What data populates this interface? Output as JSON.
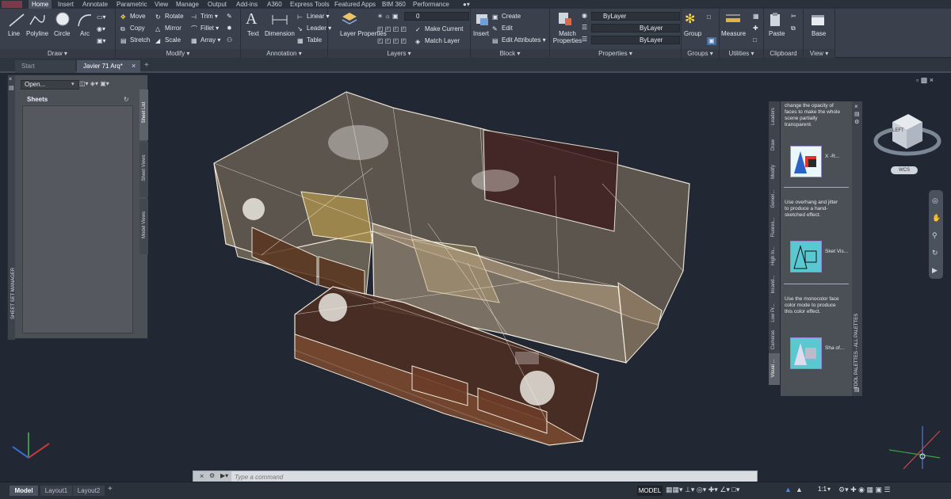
{
  "ribbon_tabs": [
    "Home",
    "Insert",
    "Annotate",
    "Parametric",
    "View",
    "Manage",
    "Output",
    "Add-ins",
    "A360",
    "Express Tools",
    "Featured Apps",
    "BIM 360",
    "Performance"
  ],
  "draw": {
    "title": "Draw",
    "line": "Line",
    "polyline": "Polyline",
    "circle": "Circle",
    "arc": "Arc"
  },
  "modify": {
    "title": "Modify",
    "move": "Move",
    "rotate": "Rotate",
    "trim": "Trim",
    "copy": "Copy",
    "mirror": "Mirror",
    "fillet": "Fillet",
    "stretch": "Stretch",
    "scale": "Scale",
    "array": "Array"
  },
  "annotation": {
    "title": "Annotation",
    "text": "Text",
    "dimension": "Dimension",
    "linear": "Linear",
    "leader": "Leader",
    "table": "Table"
  },
  "layers": {
    "title": "Layers",
    "layer_properties": "Layer Properties",
    "current_layer": "0",
    "make_current": "Make Current",
    "match_layer": "Match Layer"
  },
  "block": {
    "title": "Block",
    "insert": "Insert",
    "create": "Create",
    "edit": "Edit",
    "edit_attributes": "Edit Attributes"
  },
  "properties": {
    "title": "Properties",
    "match_properties": "Match Properties",
    "bylayer1": "ByLayer",
    "bylayer2": "ByLayer",
    "bylayer3": "ByLayer"
  },
  "groups": {
    "title": "Groups",
    "group": "Group"
  },
  "utilities": {
    "title": "Utilities",
    "measure": "Measure"
  },
  "clipboard": {
    "title": "Clipboard",
    "paste": "Paste"
  },
  "view": {
    "title": "View",
    "base": "Base"
  },
  "doc_tabs": [
    "Start",
    "Javier 71 Arq*"
  ],
  "ssm": {
    "open": "Open...",
    "sheets": "Sheets",
    "title": "SHEET SET MANAGER",
    "side_tabs": [
      "Sheet List",
      "Sheet Views",
      "Model Views"
    ]
  },
  "palette": {
    "title": "TOOL PALETTES - ALL PALETTES",
    "side_tabs": [
      "Leaders",
      "Draw",
      "Modify",
      "Generi...",
      "Fluores...",
      "High In...",
      "Incand...",
      "Low Pr...",
      "Cameras",
      "Visual ..."
    ],
    "intro": "change the opacity of faces to make the whole scene partially transparent.",
    "item1_label": "X -R...",
    "desc2": "Use overhang and jitter to produce a hand-sketched effect.",
    "item2_label": "Sket Vis...",
    "desc3": "Use the monocolor face color mode to produce this color effect.",
    "item3_label": "Sha of..."
  },
  "viewcube": {
    "face": "LEFT",
    "wcs": "WCS"
  },
  "command": {
    "placeholder": "Type a command"
  },
  "layout_tabs": [
    "Model",
    "Layout1",
    "Layout2"
  ],
  "status": {
    "model": "MODEL",
    "scale": "1:1"
  }
}
